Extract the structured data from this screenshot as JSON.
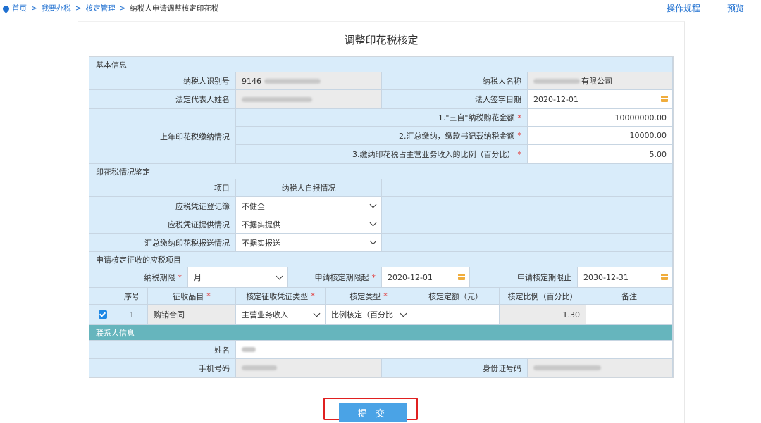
{
  "breadcrumb": [
    "首页",
    "我要办税",
    "核定管理",
    "纳税人申请调整核定印花税"
  ],
  "breadcrumb_sep": ">",
  "top_links": {
    "rules": "操作规程",
    "preview": "预览"
  },
  "form_title": "调整印花税核定",
  "basic_info": {
    "section": "基本信息",
    "taxpayer_id_label": "纳税人识别号",
    "taxpayer_id_value": "9146",
    "taxpayer_name_label": "纳税人名称",
    "taxpayer_name_value": "有限公司",
    "legal_rep_label": "法定代表人姓名",
    "sign_date_label": "法人签字日期",
    "sign_date_value": "2020-12-01",
    "last_year_label": "上年印花税缴纳情况",
    "item1_label": "1.\"三自\"纳税购花金额",
    "item1_value": "10000000.00",
    "item2_label": "2.汇总缴纳，缴款书记载纳税金额",
    "item2_value": "10000.00",
    "item3_label": "3.缴纳印花税占主营业务收入的比例（百分比）",
    "item3_value": "5.00"
  },
  "appraisal": {
    "section": "印花税情况鉴定",
    "col_item": "项目",
    "col_self": "纳税人自报情况",
    "rows": [
      {
        "label": "应税凭证登记簿",
        "value": "不健全"
      },
      {
        "label": "应税凭证提供情况",
        "value": "不据实提供"
      },
      {
        "label": "汇总缴纳印花税报送情况",
        "value": "不据实报送"
      }
    ]
  },
  "application": {
    "section": "申请核定征收的应税项目",
    "period_label": "纳税期限",
    "period_value": "月",
    "start_label": "申请核定期限起",
    "start_value": "2020-12-01",
    "end_label": "申请核定期限止",
    "end_value": "2030-12-31",
    "headers": [
      "序号",
      "征收品目",
      "核定征收凭证类型",
      "核定类型",
      "核定定额（元）",
      "核定比例（百分比）",
      "备注"
    ],
    "rows": [
      {
        "no": "1",
        "item": "购销合同",
        "voucher_type": "主营业务收入",
        "check_type": "比例核定（百分比",
        "quota": "",
        "ratio": "1.30",
        "remark": ""
      }
    ]
  },
  "contact": {
    "section": "联系人信息",
    "name_label": "姓名",
    "phone_label": "手机号码",
    "id_label": "身份证号码"
  },
  "submit_label": "提 交",
  "colors": {
    "link": "#1e6fd0",
    "label_bg": "#d9ecfa",
    "teal": "#66b5bd",
    "submit": "#4aa3e6",
    "highlight": "#e02020"
  }
}
